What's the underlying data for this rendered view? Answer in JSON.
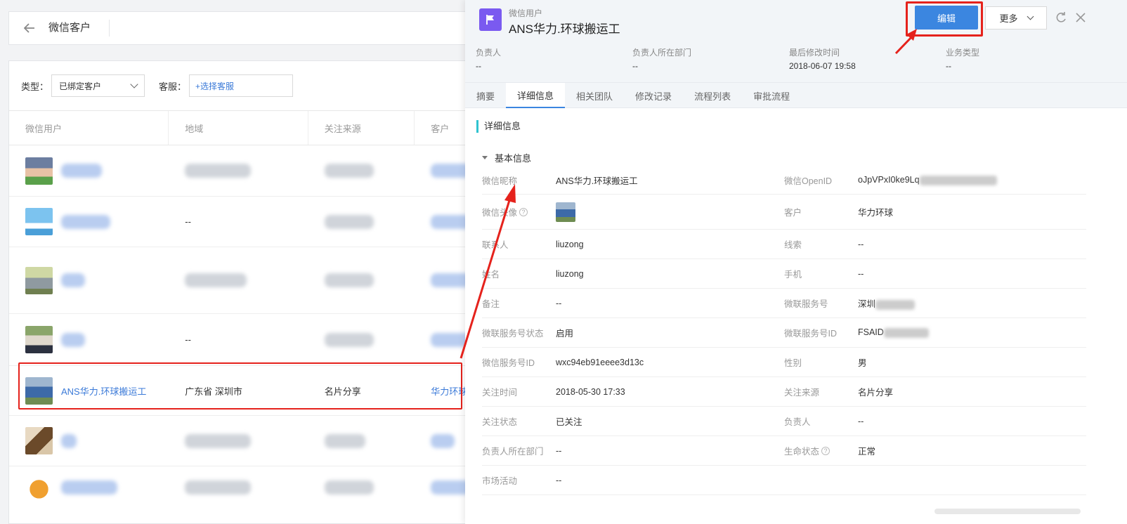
{
  "left": {
    "title": "微信客户",
    "filters": {
      "type_label": "类型：",
      "type_value": "已绑定客户",
      "service_label": "客服：",
      "service_placeholder": "+选择客服"
    },
    "columns": [
      "微信用户",
      "地域",
      "关注来源",
      "客户"
    ],
    "rows": [
      {
        "name": "",
        "region": "",
        "source": "",
        "customer": "",
        "blurred": true
      },
      {
        "name": "",
        "region": "--",
        "source": "",
        "customer": "",
        "blurred": true
      },
      {
        "name": "",
        "region": "",
        "source": "",
        "customer": "",
        "blurred": true
      },
      {
        "name": "",
        "region": "--",
        "source": "",
        "customer": "",
        "blurred": true
      },
      {
        "name": "ANS华力.环球搬运工",
        "region": "广东省 深圳市",
        "source": "名片分享",
        "customer": "华力环球",
        "blurred": false
      },
      {
        "name": "",
        "region": "",
        "source": "",
        "customer": "",
        "blurred": true
      },
      {
        "name": "",
        "region": "",
        "source": "",
        "customer": "",
        "blurred": true
      }
    ]
  },
  "right": {
    "object_type": "微信用户",
    "object_name": "ANS华力.环球搬运工",
    "edit_label": "编辑",
    "more_label": "更多",
    "meta": [
      {
        "key": "负责人",
        "value": "--"
      },
      {
        "key": "负责人所在部门",
        "value": "--"
      },
      {
        "key": "最后修改时间",
        "value": "2018-06-07 19:58"
      },
      {
        "key": "业务类型",
        "value": "--"
      }
    ],
    "tabs": [
      "摘要",
      "详细信息",
      "相关团队",
      "修改记录",
      "流程列表",
      "审批流程"
    ],
    "active_tab": 1,
    "section_title": "详细信息",
    "group_title": "基本信息",
    "fields": [
      {
        "lk": "微信昵称",
        "lv": "ANS华力.环球搬运工",
        "rk": "微信OpenID",
        "rv": "oJpVPxI0ke9Lq"
      },
      {
        "lk": "微信头像",
        "lv": "",
        "rk": "客户",
        "rv": "华力环球"
      },
      {
        "lk": "联系人",
        "lv": "liuzong",
        "rk": "线索",
        "rv": "--"
      },
      {
        "lk": "姓名",
        "lv": "liuzong",
        "rk": "手机",
        "rv": "--"
      },
      {
        "lk": "备注",
        "lv": "--",
        "rk": "微联服务号",
        "rv": "深圳"
      },
      {
        "lk": "微联服务号状态",
        "lv": "启用",
        "rk": "微联服务号ID",
        "rv": "FSAID"
      },
      {
        "lk": "微信服务号ID",
        "lv": "wxc94eb91eeee3d13c",
        "rk": "性别",
        "rv": "男"
      },
      {
        "lk": "关注时间",
        "lv": "2018-05-30 17:33",
        "rk": "关注来源",
        "rv": "名片分享"
      },
      {
        "lk": "关注状态",
        "lv": "已关注",
        "rk": "负责人",
        "rv": "--"
      },
      {
        "lk": "负责人所在部门",
        "lv": "--",
        "rk": "生命状态",
        "rv": "正常"
      },
      {
        "lk": "市场活动",
        "lv": "--",
        "rk": "",
        "rv": ""
      }
    ]
  },
  "colors": {
    "accent": "#3b86e0",
    "link": "#3b7ad8",
    "annotation_red": "#e5221c",
    "flag_tile": "#7a5af0",
    "section_bar": "#2fc3d0"
  }
}
